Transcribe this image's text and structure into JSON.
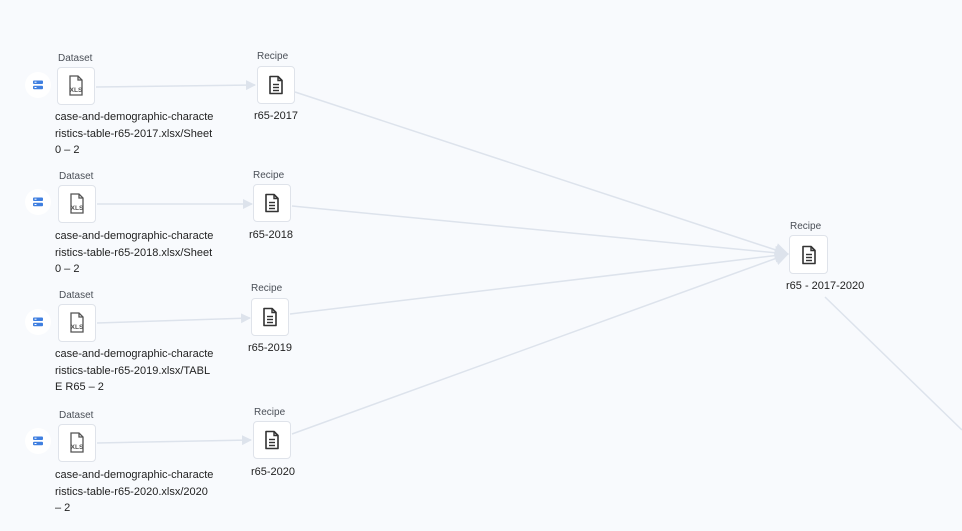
{
  "datasets": [
    {
      "type_label": "Dataset",
      "file_type": "XLS",
      "name": "case-and-demographic-characteristics-table-r65-2017.xlsx/Sheet0 – 2",
      "source_icon": "database-source-icon"
    },
    {
      "type_label": "Dataset",
      "file_type": "XLS",
      "name": "case-and-demographic-characteristics-table-r65-2018.xlsx/Sheet0 – 2",
      "source_icon": "database-source-icon"
    },
    {
      "type_label": "Dataset",
      "file_type": "XLS",
      "name": "case-and-demographic-characteristics-table-r65-2019.xlsx/TABLE R65 – 2",
      "source_icon": "database-source-icon"
    },
    {
      "type_label": "Dataset",
      "file_type": "XLS",
      "name": "case-and-demographic-characteristics-table-r65-2020.xlsx/2020 – 2",
      "source_icon": "database-source-icon"
    }
  ],
  "recipes": [
    {
      "type_label": "Recipe",
      "name": "r65-2017",
      "icon": "recipe-document-icon"
    },
    {
      "type_label": "Recipe",
      "name": "r65-2018",
      "icon": "recipe-document-icon"
    },
    {
      "type_label": "Recipe",
      "name": "r65-2019",
      "icon": "recipe-document-icon"
    },
    {
      "type_label": "Recipe",
      "name": "r65-2020",
      "icon": "recipe-document-icon"
    }
  ],
  "union_recipe": {
    "type_label": "Recipe",
    "name": "r65 - 2017-2020",
    "icon": "recipe-document-icon"
  },
  "colors": {
    "canvas_background": "#f8fafd",
    "edge": "#dde3ec",
    "source_icon": "#3f7fe0",
    "node_border": "#dfe3ea"
  }
}
